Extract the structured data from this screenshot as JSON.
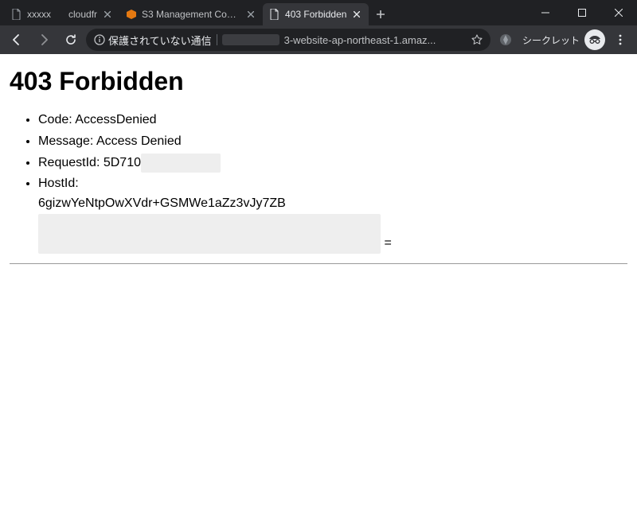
{
  "tabs": [
    {
      "label": "cloudfr"
    },
    {
      "label": "S3 Management Conso"
    },
    {
      "label": "403 Forbidden"
    }
  ],
  "toolbar": {
    "not_secure": "保護されていない通信",
    "url_visible": "3-website-ap-northeast-1.amaz...",
    "incognito_label": "シークレット"
  },
  "page": {
    "heading": "403 Forbidden",
    "items": {
      "code_label": "Code:",
      "code_value": "AccessDenied",
      "message_label": "Message:",
      "message_value": "Access Denied",
      "requestid_label": "RequestId:",
      "requestid_value_visible": "5D710",
      "hostid_label": "HostId:",
      "hostid_value_visible": "6gizwYeNtpOwXVdr+GSMWe1aZz3vJy7ZB",
      "hostid_trailing": "="
    }
  }
}
